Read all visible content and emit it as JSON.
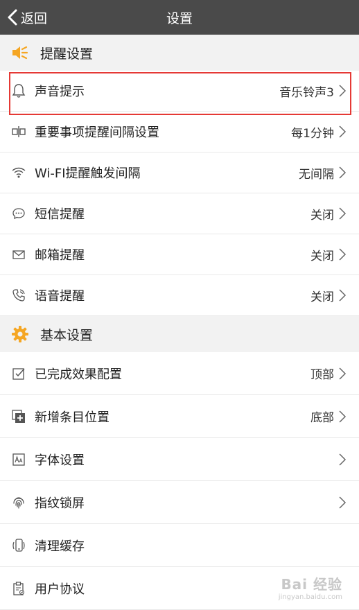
{
  "header": {
    "back_label": "返回",
    "title": "设置"
  },
  "sections": [
    {
      "title": "提醒设置",
      "icon": "speaker-icon",
      "items": [
        {
          "label": "声音提示",
          "value": "音乐铃声3",
          "icon": "bell-icon",
          "chevron": true
        },
        {
          "label": "重要事项提醒间隔设置",
          "value": "每1分钟",
          "icon": "interval-icon",
          "chevron": true
        },
        {
          "label": "Wi-FI提醒触发间隔",
          "value": "无间隔",
          "icon": "wifi-icon",
          "chevron": true
        },
        {
          "label": "短信提醒",
          "value": "关闭",
          "icon": "chat-bubble-icon",
          "chevron": true
        },
        {
          "label": "邮箱提醒",
          "value": "关闭",
          "icon": "envelope-icon",
          "chevron": true
        },
        {
          "label": "语音提醒",
          "value": "关闭",
          "icon": "phone-icon",
          "chevron": true
        }
      ]
    },
    {
      "title": "基本设置",
      "icon": "gear-icon",
      "items": [
        {
          "label": "已完成效果配置",
          "value": "顶部",
          "icon": "checkbox-icon",
          "chevron": true
        },
        {
          "label": "新增条目位置",
          "value": "底部",
          "icon": "add-item-icon",
          "chevron": true
        },
        {
          "label": "字体设置",
          "value": "",
          "icon": "font-icon",
          "chevron": true
        },
        {
          "label": "指纹锁屏",
          "value": "",
          "icon": "fingerprint-icon",
          "chevron": true
        },
        {
          "label": "清理缓存",
          "value": "",
          "icon": "phone-clean-icon",
          "chevron": false
        },
        {
          "label": "用户协议",
          "value": "",
          "icon": "clipboard-icon",
          "chevron": false
        }
      ]
    }
  ],
  "colors": {
    "topbar": "#4a4a4a",
    "accent": "#f5a623",
    "highlight": "#e53935",
    "section_bg": "#f2f2f2"
  },
  "watermark": {
    "line1": "Bai 经验",
    "line2": "jingyan.baidu.com"
  }
}
